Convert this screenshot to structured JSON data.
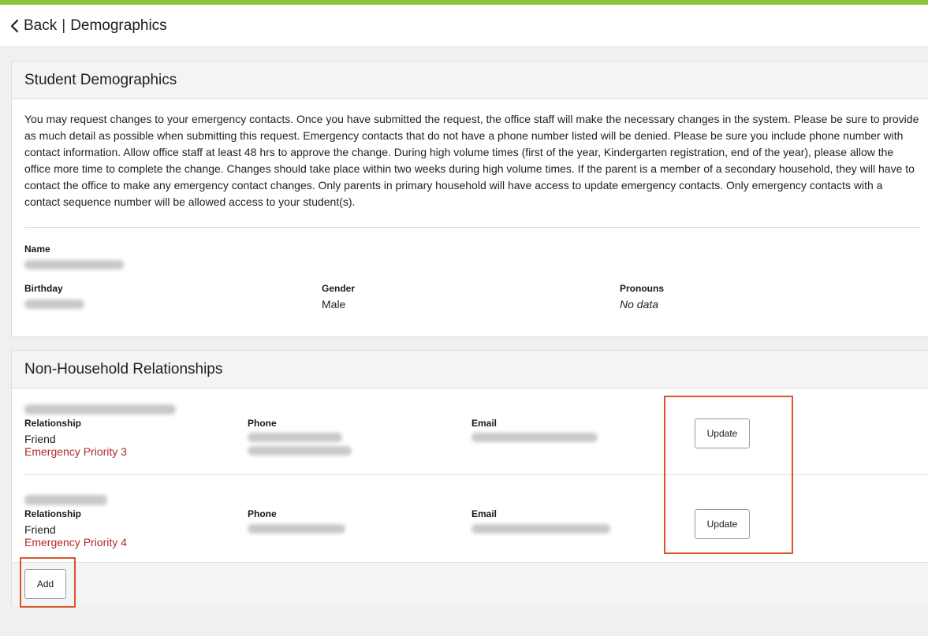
{
  "header": {
    "back_label": "Back",
    "separator": "|",
    "title": "Demographics"
  },
  "student_section": {
    "title": "Student Demographics",
    "intro": "You may request changes to your emergency contacts. Once you have submitted the request, the office staff will make the necessary changes in the system. Please be sure to provide as much detail as possible when submitting this request. Emergency contacts that do not have a phone number listed will be denied. Please be sure you include phone number with contact information. Allow office staff at least 48 hrs to approve the change. During high volume times (first of the year, Kindergarten registration, end of the year), please allow the office more time to complete the change. Changes should take place within two weeks during high volume times. If the parent is a member of a secondary household, they will have to contact the office to make any emergency contact changes. Only parents in primary household will have access to update emergency contacts. Only emergency contacts with a contact sequence number will be allowed access to your student(s).",
    "name_label": "Name",
    "birthday_label": "Birthday",
    "gender_label": "Gender",
    "gender_value": "Male",
    "pronouns_label": "Pronouns",
    "pronouns_value": "No data"
  },
  "relationships_section": {
    "title": "Non-Household Relationships",
    "items": [
      {
        "relationship_label": "Relationship",
        "relationship_value": "Friend",
        "priority": "Emergency Priority 3",
        "phone_label": "Phone",
        "email_label": "Email",
        "update_label": "Update"
      },
      {
        "relationship_label": "Relationship",
        "relationship_value": "Friend",
        "priority": "Emergency Priority 4",
        "phone_label": "Phone",
        "email_label": "Email",
        "update_label": "Update"
      }
    ],
    "add_label": "Add"
  },
  "colors": {
    "accent_bar": "#8cc63f",
    "priority_text": "#b3282d",
    "highlight_box": "#d9532c"
  }
}
